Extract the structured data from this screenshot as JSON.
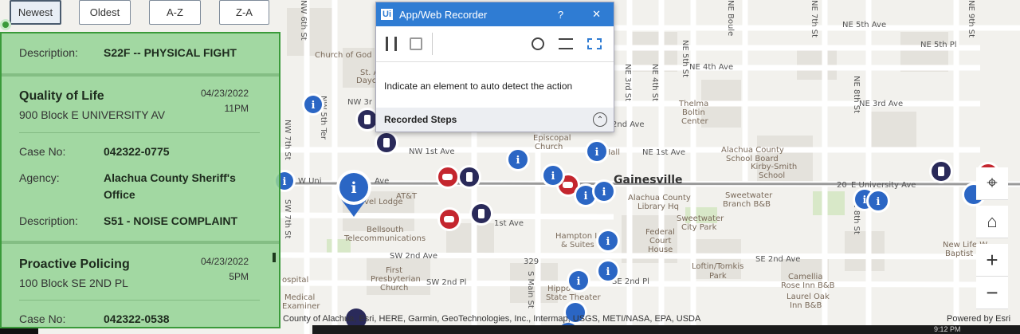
{
  "sort_buttons": [
    {
      "label": "Newest"
    },
    {
      "label": "Oldest"
    },
    {
      "label": "A-Z"
    },
    {
      "label": "Z-A"
    }
  ],
  "incident_list": {
    "top_partial": {
      "description_label": "Description:",
      "description_value": "S22F -- PHYSICAL FIGHT"
    },
    "items": [
      {
        "title": "Quality of Life",
        "address": "900 Block E UNIVERSITY AV",
        "date": "04/23/2022",
        "time": "11PM",
        "case_label": "Case No:",
        "case_value": "042322-0775",
        "agency_label": "Agency:",
        "agency_value_line1": "Alachua County Sheriff's",
        "agency_value_line2": "Office",
        "description_label": "Description:",
        "description_value": "S51 - NOISE COMPLAINT"
      },
      {
        "title": "Proactive Policing",
        "address": "100 Block SE 2ND PL",
        "date": "04/23/2022",
        "time": "5PM",
        "case_label": "Case No:",
        "case_value": "042322-0538"
      }
    ]
  },
  "recorder": {
    "app_icon_text": "Ui",
    "title": "App/Web Recorder",
    "help": "?",
    "close": "✕",
    "status_text": "Indicate an element to auto detect the action",
    "steps_label": "Recorded Steps"
  },
  "map": {
    "city_label": "Gainesville",
    "labels": {
      "church_of_god": "Church of God",
      "st_a": "St. A",
      "dayc": "Dayc",
      "nw3rd": "NW 3r",
      "nw1st": "NW 1st Ave",
      "w_uni": "W Uni",
      "ave": "Ave",
      "att": "AT&T",
      "travel_lodge": "avel Lodge",
      "bellsouth": "Bellsouth",
      "telecom": "Telecommunications",
      "sw2nd_ave": "SW 2nd Ave",
      "sw2nd_pl": "SW 2nd Pl",
      "first_pres1": "First",
      "first_pres2": "Presbyterian",
      "first_pres3": "Church",
      "hippodrome": "Hippo",
      "state_theater": "State Theater",
      "hospital": "ospital",
      "medical": "Medical",
      "examiner": "Examiner",
      "episcopal": "Episcopal",
      "church": "Church",
      "city_hall": "City Hall",
      "first_ave_e": "1st Ave",
      "hampton": "Hampton I",
      "suites": "& Suites",
      "ne1st": "NE 1st Ave",
      "ne2nd": "2nd Ave",
      "ne3rd": "NE 3rd Ave",
      "ne4th": "NE 4th Ave",
      "ne5th": "NE 5th Ave",
      "ne5th_pl": "NE 5th Pl",
      "thelma": "Thelma",
      "boltin": "Boltin",
      "center": "Center",
      "alachua_school1": "Alachua County",
      "alachua_school2": "School Board",
      "kirby1": "Kirby-Smith",
      "kirby2": "School",
      "library1": "Alachua County",
      "library2": "Library Hq",
      "sweetwater_bb1": "Sweetwater",
      "sweetwater_bb2": "Branch B&B",
      "sweetwater_park1": "Sweetwater",
      "sweetwater_park2": "City Park",
      "federal1": "Federal",
      "federal2": "Court",
      "federal3": "House",
      "loftin1": "Loftin/Tomkis",
      "loftin2": "Park",
      "se2nd_ave": "SE 2nd Ave",
      "se2nd_pl": "SE 2nd Pl",
      "camellia1": "Camellia",
      "camellia2": "Rose Inn B&B",
      "laurel1": "Laurel Oak",
      "laurel2": "Inn B&B",
      "e_univ": "E University Ave",
      "newlife1": "New Life W",
      "newlife2": "Baptist C",
      "se8th": "SE 8th St",
      "route20a": "20",
      "route20b": "20",
      "route329": "329",
      "nw6th": "NW 6th St",
      "nw5th": "NW 5th Ter",
      "nw7th": "NW 7th St",
      "sw7th": "SW 7th St",
      "ne7th": "NE 7th St",
      "ne8th": "NE 8th St",
      "ne5thst": "NE 5th St",
      "ne4thst": "NE 4th St",
      "ne3rdst": "NE 3rd St",
      "ne_boule": "NE Boule",
      "main_st": "S Main St",
      "ne9th": "NE 9th St"
    },
    "attribution": "County of Alachua, Esri, HERE, Garmin, GeoTechnologies, Inc., Intermap, USGS, METI/NASA, EPA, USDA",
    "powered_by": "Powered by Esri",
    "controls": {
      "locate": "⌖",
      "home": "⌂",
      "zoom_in": "+",
      "zoom_out": "−"
    },
    "taskbar_time": "9:12 PM"
  }
}
